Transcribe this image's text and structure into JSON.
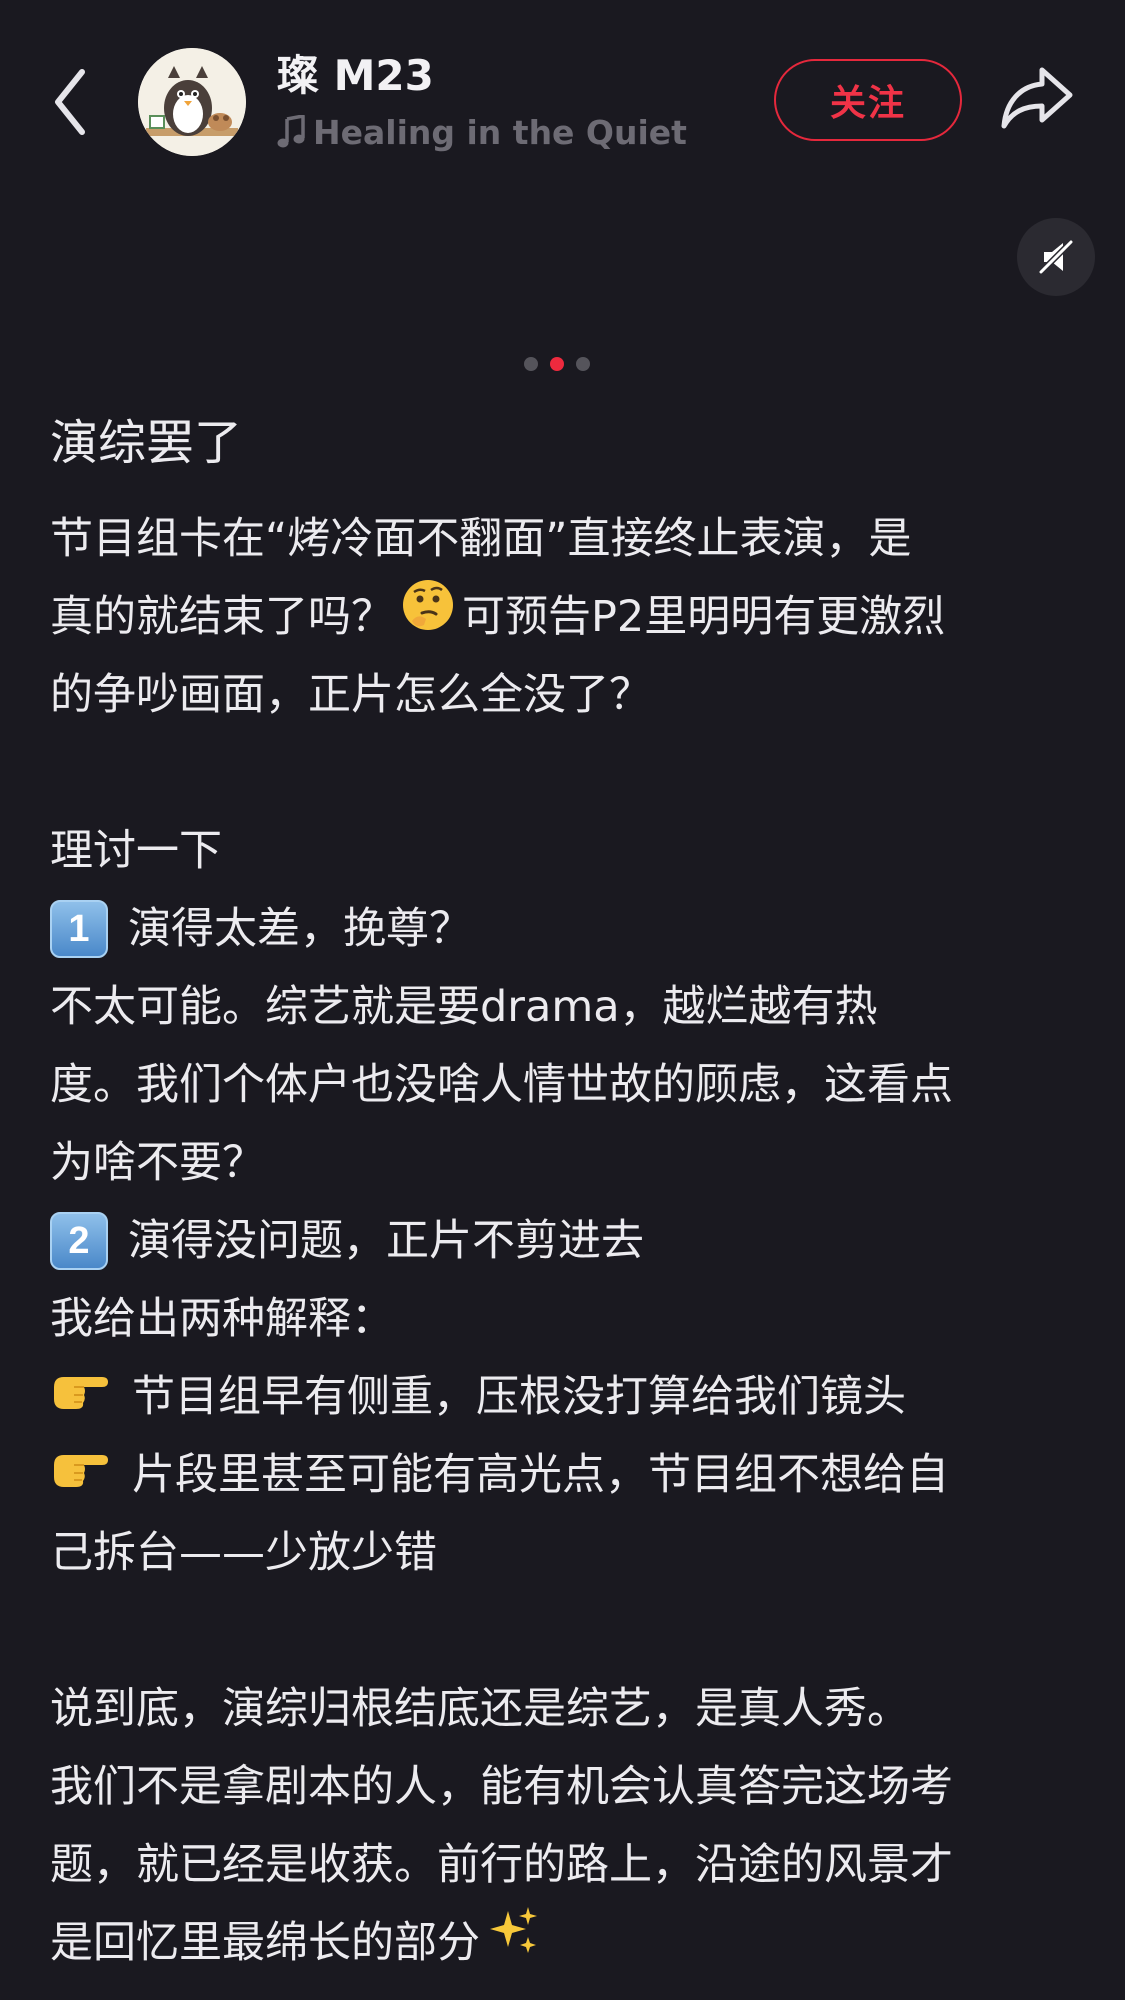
{
  "header": {
    "author_name": "璨 M23",
    "music_title": "Healing in the Quiet",
    "follow_label": "关注",
    "back_icon": "chevron-left-icon",
    "share_icon": "share-arrow-icon",
    "music_icon": "music-note-icon"
  },
  "media": {
    "mute_icon": "speaker-muted-icon",
    "carousel_total": 3,
    "carousel_active_index": 1
  },
  "post": {
    "title": "演综罢了",
    "p1_l1": "节目组卡在“烤冷面不翻面”直接终止表演，是",
    "p1_l2a": "真的就结束了吗？",
    "p1_l2b": "可预告P2里明明有更激烈",
    "p1_l3": "的争吵画面，正片怎么全没了？",
    "p2_l1": "理讨一下",
    "item1_num": "1",
    "item1_text": "演得太差，挽尊？",
    "item1_l1": "不太可能。综艺就是要drama，越烂越有热",
    "item1_l2": "度。我们个体户也没啥人情世故的顾虑，这看点",
    "item1_l3": "为啥不要？",
    "item2_num": "2",
    "item2_text": "演得没问题，正片不剪进去",
    "item2_l1": "我给出两种解释：",
    "bullet1": "节目组早有侧重，压根没打算给我们镜头",
    "bullet2_l1": "片段里甚至可能有高光点，节目组不想给自",
    "bullet2_l2": "己拆台——少放少错",
    "p3_l1": "说到底，演综归根结底还是综艺，是真人秀。",
    "p3_l2": "我们不是拿剧本的人，能有机会认真答完这场考",
    "p3_l3": "题，就已经是收获。前行的路上，沿途的风景才",
    "p3_l4": "是回忆里最绵长的部分",
    "emoji_thinking": "thinking-face-icon",
    "emoji_pointing": "backhand-index-pointing-right-icon",
    "emoji_sparkles": "sparkles-icon"
  },
  "colors": {
    "background": "#1a1920",
    "accent": "#e5283c",
    "text": "#ecebef",
    "muted": "#6d6b74"
  }
}
